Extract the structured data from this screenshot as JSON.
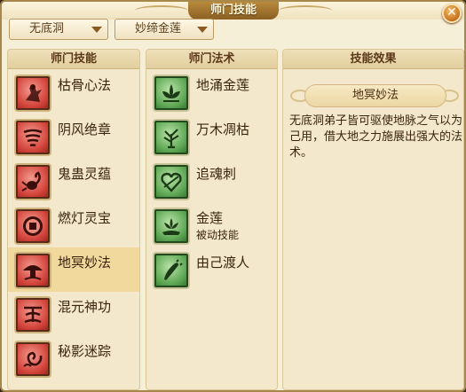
{
  "window": {
    "title": "师门技能",
    "close_icon": "close-icon"
  },
  "filters": {
    "sect": "无底洞",
    "skill": "妙缔金莲"
  },
  "panels": {
    "master_skills": {
      "header": "师门技能",
      "selected_index": 4,
      "items": [
        {
          "label": "枯骨心法",
          "icon": "dancer-icon"
        },
        {
          "label": "阴风绝章",
          "icon": "whirlwind-icon"
        },
        {
          "label": "鬼蛊灵蕴",
          "icon": "scorpion-icon"
        },
        {
          "label": "燃灯灵宝",
          "icon": "coin-icon"
        },
        {
          "label": "地冥妙法",
          "icon": "mushroom-icon"
        },
        {
          "label": "混元神功",
          "icon": "vortex-icon"
        },
        {
          "label": "秘影迷踪",
          "icon": "swirl-icon"
        }
      ]
    },
    "spells": {
      "header": "师门法术",
      "items": [
        {
          "label": "地涌金莲",
          "sub": "",
          "icon": "lotus-icon"
        },
        {
          "label": "万木凋枯",
          "sub": "",
          "icon": "tree-icon"
        },
        {
          "label": "追魂刺",
          "sub": "",
          "icon": "heart-icon"
        },
        {
          "label": "金莲",
          "sub": "被动技能",
          "icon": "flower-icon"
        },
        {
          "label": "由己渡人",
          "sub": "",
          "icon": "sword-icon"
        }
      ]
    },
    "effect": {
      "header": "技能效果",
      "name": "地冥妙法",
      "description": "无底洞弟子皆可驱使地脉之气以为己用，借大地之力施展出强大的法术。"
    }
  }
}
